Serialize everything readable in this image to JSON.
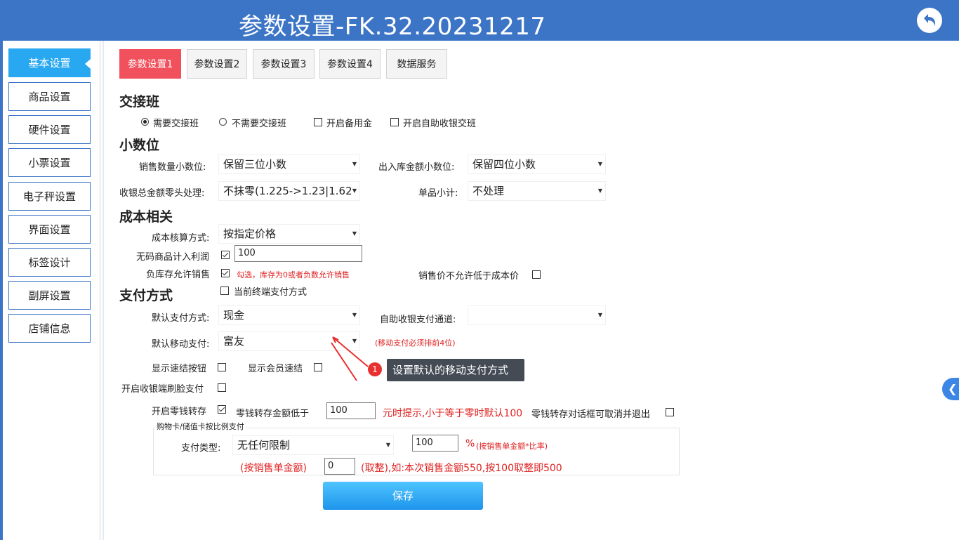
{
  "header": {
    "title": "参数设置-FK.32.20231217",
    "back_icon": "undo-arrow-icon"
  },
  "sidebar": {
    "items": [
      {
        "label": "基本设置"
      },
      {
        "label": "商品设置"
      },
      {
        "label": "硬件设置"
      },
      {
        "label": "小票设置"
      },
      {
        "label": "电子秤设置"
      },
      {
        "label": "界面设置"
      },
      {
        "label": "标签设计"
      },
      {
        "label": "副屏设置"
      },
      {
        "label": "店铺信息"
      }
    ],
    "active_index": 0
  },
  "tabs": [
    {
      "label": "参数设置1"
    },
    {
      "label": "参数设置2"
    },
    {
      "label": "参数设置3"
    },
    {
      "label": "参数设置4"
    },
    {
      "label": "数据服务"
    }
  ],
  "shift": {
    "title": "交接班",
    "need": "需要交接班",
    "no_need": "不需要交接班",
    "reserve": "开启备用金",
    "self": "开启自助收银交班"
  },
  "decimal": {
    "title": "小数位",
    "sales_qty_label": "销售数量小数位:",
    "sales_qty_value": "保留三位小数",
    "stock_amt_label": "出入库金额小数位:",
    "stock_amt_value": "保留四位小数",
    "rounding_label": "收银总金额零头处理:",
    "rounding_value": "不抹零(1.225->1.23|1.62",
    "subtotal_label": "单品小计:",
    "subtotal_value": "不处理"
  },
  "cost": {
    "title": "成本相关",
    "method_label": "成本核算方式:",
    "method_value": "按指定价格",
    "nocode_label": "无码商品计入利润",
    "nocode_value": "100",
    "negative_label": "负库存允许销售",
    "negative_hint": "勾选，库存为0或者负数允许销售",
    "below_cost_label": "销售价不允许低于成本价"
  },
  "payment": {
    "title": "支付方式",
    "terminal_label": "当前终端支付方式",
    "default_label": "默认支付方式:",
    "default_value": "现金",
    "self_channel_label": "自助收银支付通道:",
    "self_channel_value": "",
    "mobile_label": "默认移动支付:",
    "mobile_value": "富友",
    "mobile_hint": "(移动支付必须排前4位)",
    "quick_settle_label": "显示速结按钮",
    "member_quick_label": "显示会员速结",
    "face_pay_label": "开启收银端刷脸支付",
    "change_store_label": "开启零钱转存",
    "change_below_label": "零钱转存金额低于",
    "change_below_value": "100",
    "change_hint": "元时提示,小于等于零时默认100",
    "change_cancel_label": "零钱转存对话框可取消并退出"
  },
  "card_group": {
    "legend": "购物卡/储值卡按比例支付",
    "type_label": "支付类型:",
    "type_value": "无任何限制",
    "ratio_value": "100",
    "ratio_hint_pct": "%",
    "ratio_hint": "(按销售单金额*比率)",
    "by_amount_label": "(按销售单金额)",
    "by_amount_value": "0",
    "round_hint": "(取整),如:本次销售金额550,按100取整即500"
  },
  "save_label": "保存",
  "tooltip": {
    "number": "1",
    "text": "设置默认的移动支付方式"
  },
  "edge_icon": "chevron-left-icon",
  "colors": {
    "header": "#3c75c6",
    "active_tab": "#f1515c",
    "active_side": "#29a8f2",
    "save": "#1e95ec"
  }
}
